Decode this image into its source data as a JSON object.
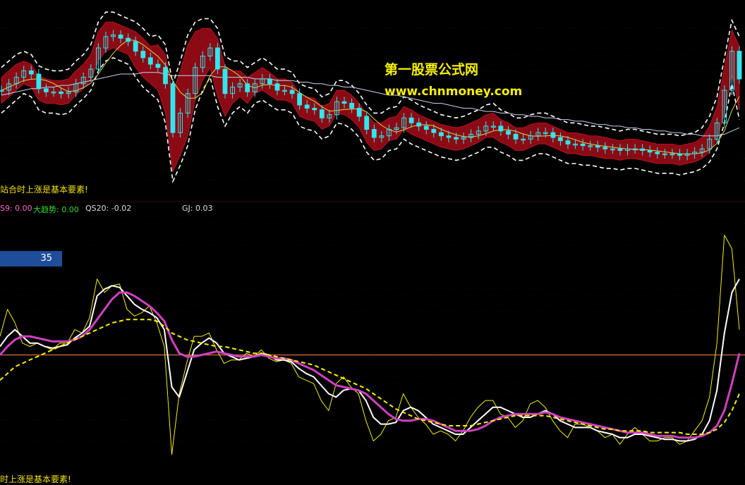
{
  "watermark": {
    "site_name": "第一股票公式网",
    "url": "www.chnmoney.com"
  },
  "notes": {
    "top": "站合时上涨是基本要素!",
    "bottom": "时上涨是基本要素!"
  },
  "indicator_bar": {
    "s9": "S9: 0.00",
    "trend": "大趋势: 0.00",
    "qs20": "QS20: -0.02",
    "gj": "GJ: 0.03"
  },
  "badge_value": "35",
  "colors": {
    "background": "#000000",
    "band_fill": "#8b0a14",
    "up_candle": "#2ee8f0",
    "down_candle": "#2ee8f0",
    "white_line": "#ffffff",
    "yellow_line": "#f5f000",
    "magenta_line": "#d040c0",
    "reference_line": "#d07040",
    "envelope": "#ffffff",
    "long_ma": "#c8d0f0"
  },
  "chart_data": [
    {
      "type": "candlestick",
      "title": "",
      "x": [
        0,
        1,
        2,
        3,
        4,
        5,
        6,
        7,
        8,
        9,
        10,
        11,
        12,
        13,
        14,
        15,
        16,
        17,
        18,
        19,
        20,
        21,
        22,
        23,
        24,
        25,
        26,
        27,
        28,
        29,
        30,
        31,
        32,
        33,
        34,
        35,
        36,
        37,
        38,
        39,
        40,
        41,
        42,
        43,
        44,
        45,
        46,
        47,
        48,
        49,
        50,
        51,
        52,
        53,
        54,
        55,
        56,
        57,
        58,
        59,
        60,
        61,
        62,
        63,
        64,
        65,
        66,
        67,
        68,
        69,
        70,
        71,
        72,
        73,
        74,
        75,
        76,
        77,
        78,
        79,
        80,
        81,
        82,
        83,
        84,
        85,
        86,
        87,
        88,
        89,
        90,
        91,
        92,
        93,
        94,
        95,
        96,
        97,
        98,
        99
      ],
      "close": [
        48,
        52,
        56,
        60,
        58,
        49,
        47,
        47,
        46,
        47,
        52,
        56,
        61,
        74,
        81,
        82,
        80,
        78,
        72,
        68,
        64,
        62,
        52,
        22,
        34,
        46,
        62,
        69,
        74,
        61,
        46,
        50,
        52,
        47,
        52,
        55,
        52,
        48,
        48,
        46,
        39,
        37,
        36,
        31,
        33,
        41,
        40,
        37,
        32,
        24,
        19,
        20,
        24,
        25,
        31,
        28,
        26,
        24,
        22,
        20,
        19,
        18,
        19,
        21,
        23,
        26,
        26,
        23,
        21,
        18,
        18,
        20,
        22,
        22,
        19,
        17,
        15,
        15,
        14,
        14,
        13,
        12,
        12,
        11,
        12,
        12,
        11,
        10,
        9,
        9,
        9,
        8,
        9,
        10,
        12,
        18,
        28,
        48,
        72,
        55
      ],
      "band_upper": [
        56,
        60,
        64,
        66,
        64,
        57,
        55,
        54,
        54,
        55,
        60,
        64,
        70,
        84,
        90,
        90,
        88,
        86,
        84,
        80,
        75,
        76,
        70,
        46,
        60,
        76,
        84,
        86,
        86,
        80,
        63,
        60,
        60,
        56,
        59,
        62,
        59,
        55,
        55,
        53,
        46,
        44,
        43,
        38,
        40,
        48,
        48,
        45,
        40,
        33,
        28,
        28,
        31,
        32,
        38,
        36,
        33,
        31,
        29,
        27,
        26,
        25,
        26,
        28,
        30,
        33,
        34,
        30,
        28,
        25,
        25,
        27,
        28,
        28,
        26,
        24,
        22,
        22,
        21,
        20,
        20,
        19,
        18,
        17,
        18,
        18,
        17,
        16,
        15,
        15,
        15,
        14,
        15,
        16,
        19,
        26,
        38,
        62,
        85,
        75
      ],
      "band_lower": [
        40,
        44,
        48,
        52,
        50,
        42,
        40,
        40,
        39,
        40,
        45,
        49,
        54,
        66,
        72,
        74,
        72,
        70,
        62,
        56,
        52,
        48,
        34,
        -2,
        8,
        20,
        42,
        54,
        62,
        44,
        32,
        40,
        44,
        40,
        46,
        48,
        45,
        42,
        42,
        40,
        32,
        30,
        29,
        24,
        26,
        34,
        33,
        30,
        25,
        16,
        11,
        12,
        17,
        18,
        24,
        21,
        19,
        17,
        15,
        13,
        12,
        11,
        12,
        14,
        16,
        19,
        19,
        16,
        14,
        11,
        11,
        13,
        15,
        15,
        13,
        11,
        9,
        9,
        8,
        8,
        7,
        6,
        6,
        5,
        6,
        6,
        5,
        4,
        3,
        3,
        3,
        2,
        3,
        4,
        6,
        10,
        18,
        34,
        58,
        36
      ],
      "long_ma": [
        45,
        46,
        47,
        48,
        49,
        49,
        50,
        50,
        51,
        51,
        52,
        53,
        54,
        55,
        56,
        57,
        58,
        58,
        58,
        59,
        59,
        59,
        58,
        57,
        57,
        57,
        57,
        57,
        57,
        56,
        56,
        56,
        56,
        56,
        55,
        55,
        55,
        54,
        54,
        54,
        53,
        53,
        52,
        52,
        51,
        51,
        50,
        50,
        49,
        48,
        47,
        46,
        45,
        45,
        44,
        43,
        42,
        41,
        40,
        40,
        39,
        38,
        37,
        37,
        36,
        35,
        35,
        34,
        34,
        33,
        33,
        32,
        32,
        31,
        31,
        30,
        30,
        29,
        29,
        28,
        27,
        27,
        26,
        26,
        25,
        25,
        24,
        24,
        23,
        23,
        22,
        22,
        21,
        21,
        20,
        20,
        20,
        21,
        23,
        25
      ],
      "ylim": [
        -10,
        100
      ],
      "xlim": [
        0,
        99
      ]
    },
    {
      "type": "line",
      "title": "",
      "x": [
        0,
        1,
        2,
        3,
        4,
        5,
        6,
        7,
        8,
        9,
        10,
        11,
        12,
        13,
        14,
        15,
        16,
        17,
        18,
        19,
        20,
        21,
        22,
        23,
        24,
        25,
        26,
        27,
        28,
        29,
        30,
        31,
        32,
        33,
        34,
        35,
        36,
        37,
        38,
        39,
        40,
        41,
        42,
        43,
        44,
        45,
        46,
        47,
        48,
        49,
        50,
        51,
        52,
        53,
        54,
        55,
        56,
        57,
        58,
        59,
        60,
        61,
        62,
        63,
        64,
        65,
        66,
        67,
        68,
        69,
        70,
        71,
        72,
        73,
        74,
        75,
        76,
        77,
        78,
        79,
        80,
        81,
        82,
        83,
        84,
        85,
        86,
        87,
        88,
        89,
        90,
        91,
        92,
        93,
        94,
        95,
        96,
        97,
        98,
        99
      ],
      "reference_line": 45,
      "series": [
        {
          "values": [
            56,
            72,
            64,
            52,
            50,
            52,
            50,
            48,
            52,
            52,
            60,
            58,
            67,
            90,
            82,
            86,
            87,
            72,
            68,
            70,
            74,
            64,
            50,
            -14,
            22,
            40,
            56,
            56,
            58,
            48,
            40,
            42,
            42,
            46,
            44,
            48,
            43,
            41,
            42,
            40,
            32,
            30,
            28,
            18,
            12,
            28,
            32,
            26,
            22,
            6,
            -6,
            -2,
            6,
            8,
            22,
            14,
            8,
            4,
            -2,
            0,
            -2,
            -6,
            0,
            8,
            14,
            18,
            18,
            10,
            8,
            2,
            6,
            16,
            18,
            14,
            6,
            0,
            -4,
            4,
            4,
            2,
            0,
            -4,
            -2,
            -8,
            -2,
            2,
            -2,
            -6,
            -6,
            -4,
            -4,
            -8,
            -6,
            0,
            6,
            20,
            52,
            116,
            108,
            60
          ]
        },
        {
          "values": [
            50,
            56,
            60,
            56,
            52,
            52,
            50,
            49,
            50,
            51,
            55,
            58,
            62,
            80,
            84,
            86,
            85,
            80,
            75,
            72,
            70,
            67,
            60,
            26,
            20,
            34,
            48,
            52,
            55,
            52,
            46,
            44,
            42,
            43,
            44,
            46,
            45,
            42,
            42,
            41,
            37,
            34,
            32,
            27,
            22,
            20,
            24,
            25,
            24,
            18,
            8,
            4,
            4,
            5,
            12,
            14,
            12,
            8,
            4,
            2,
            0,
            -2,
            -2,
            2,
            6,
            10,
            14,
            14,
            12,
            10,
            8,
            8,
            10,
            12,
            10,
            6,
            4,
            2,
            2,
            2,
            0,
            -1,
            -2,
            -4,
            -4,
            -2,
            -2,
            -3,
            -4,
            -5,
            -5,
            -6,
            -6,
            -5,
            -2,
            6,
            24,
            58,
            82,
            90
          ]
        },
        {
          "values": [
            45,
            50,
            54,
            56,
            56,
            55,
            54,
            53,
            53,
            53,
            54,
            56,
            60,
            66,
            72,
            78,
            82,
            82,
            80,
            77,
            74,
            70,
            65,
            54,
            46,
            44,
            44,
            45,
            46,
            47,
            46,
            45,
            44,
            44,
            44,
            45,
            44,
            43,
            43,
            42,
            40,
            38,
            36,
            33,
            30,
            27,
            26,
            25,
            24,
            22,
            18,
            14,
            10,
            7,
            6,
            6,
            7,
            7,
            6,
            4,
            2,
            0,
            0,
            0,
            1,
            3,
            6,
            8,
            9,
            10,
            10,
            10,
            10,
            11,
            10,
            8,
            7,
            6,
            5,
            4,
            3,
            2,
            1,
            0,
            -1,
            -1,
            -1,
            -2,
            -3,
            -3,
            -3,
            -4,
            -4,
            -4,
            -3,
            -1,
            3,
            12,
            28,
            46
          ]
        },
        {
          "values": [
            30,
            34,
            38,
            40,
            42,
            44,
            46,
            48,
            50,
            52,
            54,
            56,
            58,
            60,
            62,
            64,
            65,
            66,
            66,
            66,
            66,
            65,
            62,
            58,
            56,
            54,
            53,
            52,
            51,
            50,
            50,
            49,
            48,
            47,
            46,
            46,
            45,
            44,
            43,
            42,
            41,
            40,
            39,
            37,
            35,
            33,
            31,
            29,
            27,
            25,
            22,
            19,
            16,
            13,
            11,
            9,
            7,
            6,
            5,
            4,
            3,
            3,
            3,
            3,
            4,
            5,
            6,
            7,
            8,
            9,
            9,
            9,
            9,
            9,
            8,
            7,
            6,
            5,
            4,
            3,
            2,
            1,
            1,
            0,
            0,
            0,
            0,
            -1,
            -1,
            -1,
            -1,
            -1,
            -2,
            -2,
            -2,
            -1,
            1,
            5,
            12,
            22
          ]
        }
      ],
      "ylim": [
        -30,
        130
      ],
      "xlim": [
        0,
        99
      ]
    }
  ]
}
